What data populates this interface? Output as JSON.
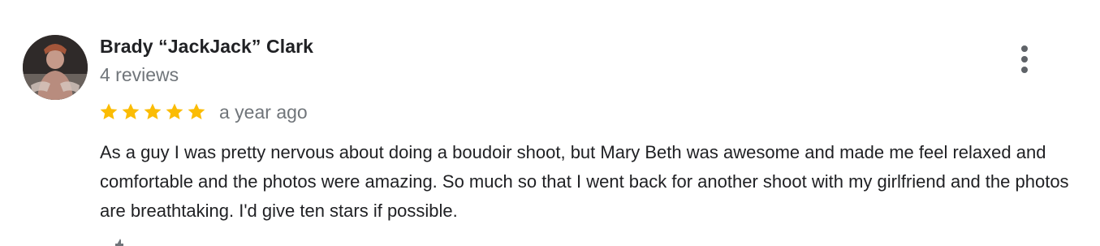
{
  "review": {
    "author_name": "Brady “JackJack” Clark",
    "review_count": "4 reviews",
    "rating": 5,
    "rating_max": 5,
    "time_ago": "a year ago",
    "text": "As a guy I was pretty nervous about doing a boudoir shoot, but Mary Beth was awesome and made me feel relaxed and comfortable and the photos were amazing. So much so that I went back for another shoot with my girlfriend and the photos are breathtaking. I'd give ten stars if possible.",
    "avatar_icon": "user-photo",
    "more_icon": "more-vert-icon",
    "star_color": "#fbbc04",
    "secondary_text_color": "#70757a"
  }
}
